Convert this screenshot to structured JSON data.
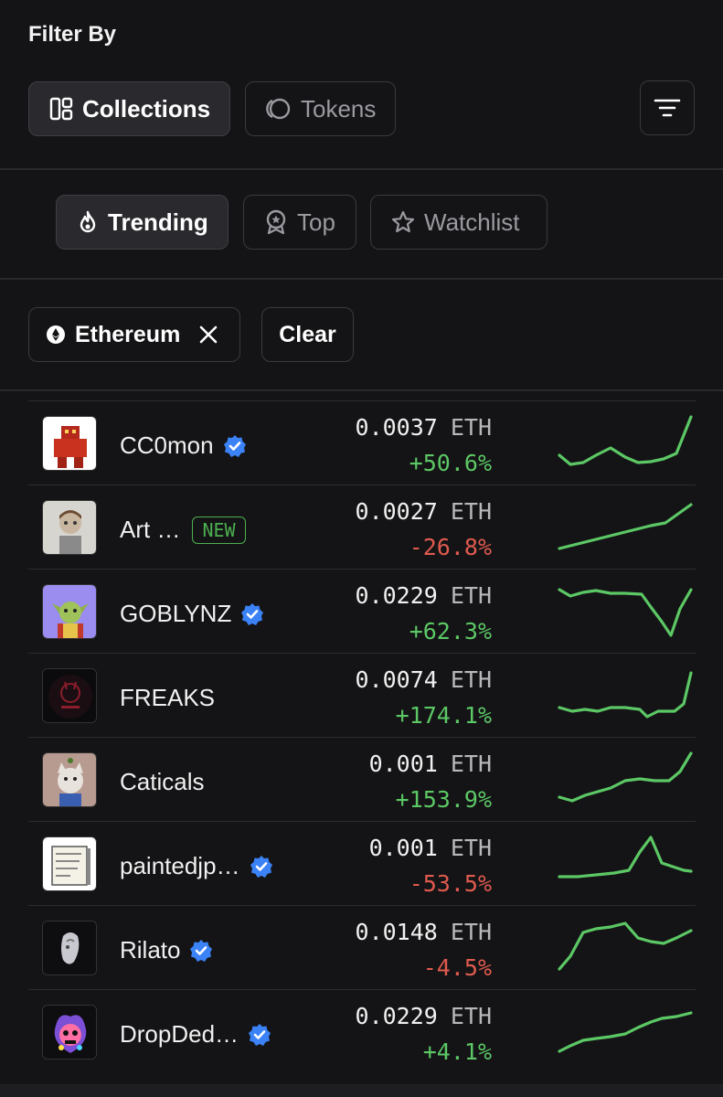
{
  "filter": {
    "title": "Filter By",
    "type_tabs": [
      {
        "label": "Collections",
        "active": true
      },
      {
        "label": "Tokens",
        "active": false
      }
    ],
    "sort_tabs": [
      {
        "label": "Trending",
        "active": true
      },
      {
        "label": "Top",
        "active": false
      },
      {
        "label": "Watchlist",
        "active": false
      }
    ],
    "chain_chip": "Ethereum",
    "clear_label": "Clear"
  },
  "colors": {
    "background": "#141416",
    "positive": "#5cc865",
    "negative": "#e05a4f",
    "verified": "#3b82f6",
    "new_badge": "#4caf50"
  },
  "collections": [
    {
      "name": "CC0mon",
      "verified": true,
      "is_new": false,
      "price": "0.0037",
      "unit": "ETH",
      "change": "+50.6%",
      "direction": "up"
    },
    {
      "name": "Art …",
      "verified": false,
      "is_new": true,
      "badge": "NEW",
      "price": "0.0027",
      "unit": "ETH",
      "change": "-26.8%",
      "direction": "down"
    },
    {
      "name": "GOBLYNZ",
      "verified": true,
      "is_new": false,
      "price": "0.0229",
      "unit": "ETH",
      "change": "+62.3%",
      "direction": "up"
    },
    {
      "name": "FREAKS",
      "verified": false,
      "is_new": false,
      "price": "0.0074",
      "unit": "ETH",
      "change": "+174.1%",
      "direction": "up"
    },
    {
      "name": "Caticals",
      "verified": false,
      "is_new": false,
      "price": "0.001",
      "unit": "ETH",
      "change": "+153.9%",
      "direction": "up"
    },
    {
      "name": "paintedjp…",
      "verified": true,
      "is_new": false,
      "price": "0.001",
      "unit": "ETH",
      "change": "-53.5%",
      "direction": "down"
    },
    {
      "name": "Rilato",
      "verified": true,
      "is_new": false,
      "price": "0.0148",
      "unit": "ETH",
      "change": "-4.5%",
      "direction": "down"
    },
    {
      "name": "DropDed…",
      "verified": true,
      "is_new": false,
      "price": "0.0229",
      "unit": "ETH",
      "change": "+4.1%",
      "direction": "up"
    }
  ]
}
